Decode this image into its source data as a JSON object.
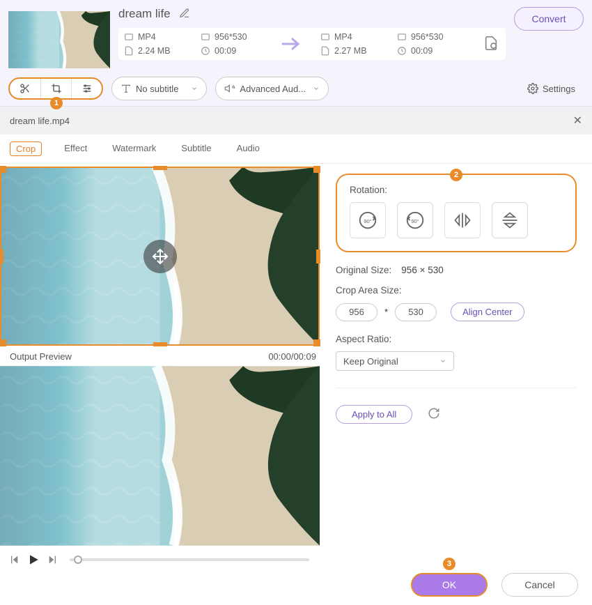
{
  "header": {
    "title": "dream life",
    "input": {
      "format": "MP4",
      "dimensions": "956*530",
      "size": "2.24 MB",
      "duration": "00:09"
    },
    "output": {
      "format": "MP4",
      "dimensions": "956*530",
      "size": "2.27 MB",
      "duration": "00:09"
    },
    "convert": "Convert",
    "subtitle": "No subtitle",
    "advancedAudio": "Advanced Aud...",
    "settings": "Settings"
  },
  "tabs": {
    "crop": "Crop",
    "effect": "Effect",
    "watermark": "Watermark",
    "subtitle": "Subtitle",
    "audio": "Audio"
  },
  "titleBar": {
    "filename": "dream life.mp4"
  },
  "preview": {
    "outputLabel": "Output Preview",
    "time": "00:00/00:09"
  },
  "rotation": {
    "label": "Rotation:"
  },
  "originalSize": {
    "label": "Original Size:",
    "value": "956 × 530"
  },
  "cropArea": {
    "label": "Crop Area Size:",
    "w": "956",
    "h": "530",
    "star": "*",
    "align": "Align Center"
  },
  "aspect": {
    "label": "Aspect Ratio:",
    "value": "Keep Original"
  },
  "applyAll": "Apply to All",
  "ok": "OK",
  "cancel": "Cancel",
  "badges": {
    "b1": "1",
    "b2": "2",
    "b3": "3"
  }
}
